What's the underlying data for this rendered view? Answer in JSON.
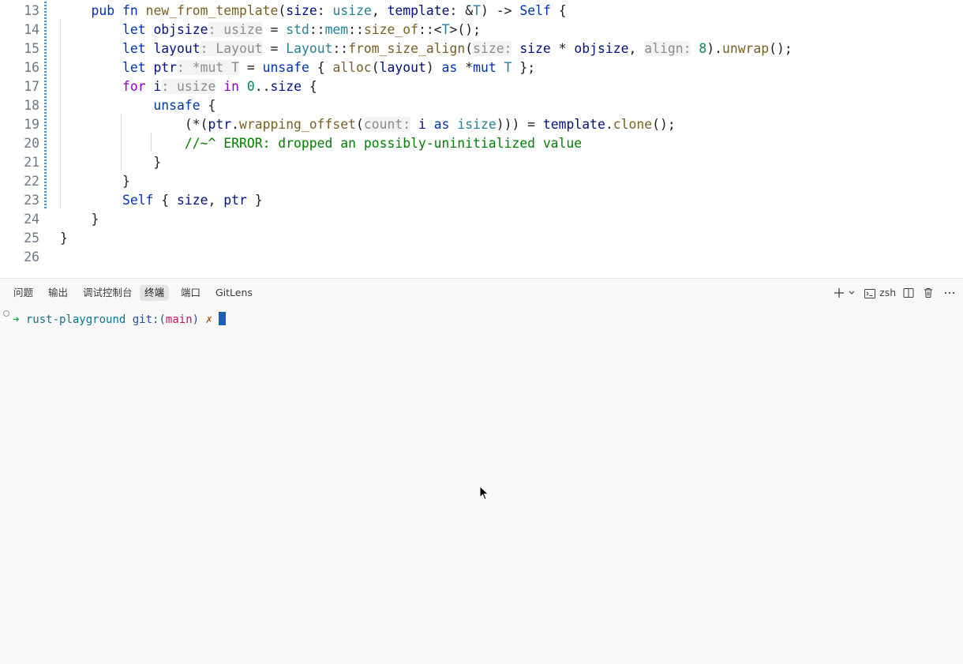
{
  "editor": {
    "lines": [
      {
        "num": "13",
        "parts": [
          {
            "t": "    ",
            "c": ""
          },
          {
            "t": "pub",
            "c": "kw"
          },
          {
            "t": " ",
            "c": ""
          },
          {
            "t": "fn",
            "c": "kw"
          },
          {
            "t": " ",
            "c": ""
          },
          {
            "t": "new_from_template",
            "c": "fn"
          },
          {
            "t": "(",
            "c": ""
          },
          {
            "t": "size",
            "c": "var"
          },
          {
            "t": ": ",
            "c": ""
          },
          {
            "t": "usize",
            "c": "ty"
          },
          {
            "t": ", ",
            "c": ""
          },
          {
            "t": "template",
            "c": "var"
          },
          {
            "t": ": &",
            "c": ""
          },
          {
            "t": "T",
            "c": "ty"
          },
          {
            "t": ") -> ",
            "c": ""
          },
          {
            "t": "Self",
            "c": "kw"
          },
          {
            "t": " {",
            "c": ""
          }
        ]
      },
      {
        "num": "14",
        "parts": [
          {
            "t": "        ",
            "c": ""
          },
          {
            "t": "let",
            "c": "kw"
          },
          {
            "t": " ",
            "c": ""
          },
          {
            "t": "objsize",
            "c": "var"
          },
          {
            "t": ": usize",
            "c": "hint"
          },
          {
            "t": " = ",
            "c": ""
          },
          {
            "t": "std",
            "c": "ty"
          },
          {
            "t": "::",
            "c": ""
          },
          {
            "t": "mem",
            "c": "ty"
          },
          {
            "t": "::",
            "c": ""
          },
          {
            "t": "size_of",
            "c": "fn"
          },
          {
            "t": "::<",
            "c": ""
          },
          {
            "t": "T",
            "c": "ty"
          },
          {
            "t": ">();",
            "c": ""
          }
        ]
      },
      {
        "num": "15",
        "parts": [
          {
            "t": "        ",
            "c": ""
          },
          {
            "t": "let",
            "c": "kw"
          },
          {
            "t": " ",
            "c": ""
          },
          {
            "t": "layout",
            "c": "var"
          },
          {
            "t": ": Layout",
            "c": "hint"
          },
          {
            "t": " = ",
            "c": ""
          },
          {
            "t": "Layout",
            "c": "ty"
          },
          {
            "t": "::",
            "c": ""
          },
          {
            "t": "from_size_align",
            "c": "fn"
          },
          {
            "t": "(",
            "c": ""
          },
          {
            "t": "size:",
            "c": "hint"
          },
          {
            "t": " ",
            "c": ""
          },
          {
            "t": "size",
            "c": "var"
          },
          {
            "t": " * ",
            "c": ""
          },
          {
            "t": "objsize",
            "c": "var"
          },
          {
            "t": ", ",
            "c": ""
          },
          {
            "t": "align:",
            "c": "hint"
          },
          {
            "t": " ",
            "c": ""
          },
          {
            "t": "8",
            "c": "num"
          },
          {
            "t": ").",
            "c": ""
          },
          {
            "t": "unwrap",
            "c": "fn"
          },
          {
            "t": "();",
            "c": ""
          }
        ]
      },
      {
        "num": "16",
        "parts": [
          {
            "t": "        ",
            "c": ""
          },
          {
            "t": "let",
            "c": "kw"
          },
          {
            "t": " ",
            "c": ""
          },
          {
            "t": "ptr",
            "c": "var"
          },
          {
            "t": ": *mut T",
            "c": "hint"
          },
          {
            "t": " = ",
            "c": ""
          },
          {
            "t": "unsafe",
            "c": "kw"
          },
          {
            "t": " { ",
            "c": ""
          },
          {
            "t": "alloc",
            "c": "fn"
          },
          {
            "t": "(",
            "c": ""
          },
          {
            "t": "layout",
            "c": "var"
          },
          {
            "t": ") ",
            "c": ""
          },
          {
            "t": "as",
            "c": "kw"
          },
          {
            "t": " *",
            "c": ""
          },
          {
            "t": "mut",
            "c": "kw"
          },
          {
            "t": " ",
            "c": ""
          },
          {
            "t": "T",
            "c": "ty"
          },
          {
            "t": " };",
            "c": ""
          }
        ]
      },
      {
        "num": "17",
        "parts": [
          {
            "t": "        ",
            "c": ""
          },
          {
            "t": "for",
            "c": "kw2"
          },
          {
            "t": " ",
            "c": ""
          },
          {
            "t": "i",
            "c": "var"
          },
          {
            "t": ": usize",
            "c": "hint"
          },
          {
            "t": " ",
            "c": ""
          },
          {
            "t": "in",
            "c": "kw2"
          },
          {
            "t": " ",
            "c": ""
          },
          {
            "t": "0",
            "c": "num"
          },
          {
            "t": "..",
            "c": ""
          },
          {
            "t": "size",
            "c": "var"
          },
          {
            "t": " {",
            "c": ""
          }
        ]
      },
      {
        "num": "18",
        "parts": [
          {
            "t": "            ",
            "c": ""
          },
          {
            "t": "unsafe",
            "c": "kw"
          },
          {
            "t": " {",
            "c": ""
          }
        ]
      },
      {
        "num": "19",
        "parts": [
          {
            "t": "                ",
            "c": ""
          },
          {
            "t": "(*(",
            "c": ""
          },
          {
            "t": "ptr",
            "c": "var"
          },
          {
            "t": ".",
            "c": ""
          },
          {
            "t": "wrapping_offset",
            "c": "fn"
          },
          {
            "t": "(",
            "c": ""
          },
          {
            "t": "count:",
            "c": "hint"
          },
          {
            "t": " ",
            "c": ""
          },
          {
            "t": "i",
            "c": "var"
          },
          {
            "t": " ",
            "c": ""
          },
          {
            "t": "as",
            "c": "kw"
          },
          {
            "t": " ",
            "c": ""
          },
          {
            "t": "isize",
            "c": "ty"
          },
          {
            "t": "))) = ",
            "c": ""
          },
          {
            "t": "template",
            "c": "var"
          },
          {
            "t": ".",
            "c": ""
          },
          {
            "t": "clone",
            "c": "fn"
          },
          {
            "t": "();",
            "c": ""
          }
        ]
      },
      {
        "num": "20",
        "parts": [
          {
            "t": "                ",
            "c": ""
          },
          {
            "t": "//~^ ERROR: dropped an possibly-uninitialized value",
            "c": "cm"
          }
        ]
      },
      {
        "num": "21",
        "parts": [
          {
            "t": "            }",
            "c": ""
          }
        ]
      },
      {
        "num": "22",
        "parts": [
          {
            "t": "        }",
            "c": ""
          }
        ]
      },
      {
        "num": "23",
        "parts": [
          {
            "t": "        ",
            "c": ""
          },
          {
            "t": "Self",
            "c": "kw"
          },
          {
            "t": " { ",
            "c": ""
          },
          {
            "t": "size",
            "c": "var"
          },
          {
            "t": ", ",
            "c": ""
          },
          {
            "t": "ptr",
            "c": "var"
          },
          {
            "t": " }",
            "c": ""
          }
        ]
      },
      {
        "num": "24",
        "parts": [
          {
            "t": "    }",
            "c": ""
          }
        ]
      },
      {
        "num": "25",
        "parts": [
          {
            "t": "}",
            "c": ""
          }
        ]
      },
      {
        "num": "26",
        "parts": []
      }
    ]
  },
  "panel": {
    "tabs": [
      {
        "label": "问题",
        "active": false
      },
      {
        "label": "输出",
        "active": false
      },
      {
        "label": "调试控制台",
        "active": false
      },
      {
        "label": "终端",
        "active": true
      },
      {
        "label": "端口",
        "active": false
      },
      {
        "label": "GitLens",
        "active": false
      }
    ],
    "shell_name": "zsh",
    "icons": [
      "plus-icon",
      "chevron-down-icon",
      "terminal-icon",
      "split-icon",
      "trash-icon",
      "more-icon"
    ]
  },
  "terminal": {
    "arrow": "➜",
    "dir": "rust-playground",
    "git_label": "git:",
    "branch_open": "(",
    "branch": "main",
    "branch_close": ")",
    "dirty": "✗"
  },
  "colors": {
    "keyword": "#0033b3",
    "control": "#8b00c9",
    "type": "#267f99",
    "function": "#795e26",
    "variable": "#001080",
    "number": "#098658",
    "comment": "#008000",
    "prompt_green": "#16a34a",
    "prompt_dir": "#0e7490",
    "branch_red": "#c2185b",
    "cursor": "#1a5fb4"
  }
}
